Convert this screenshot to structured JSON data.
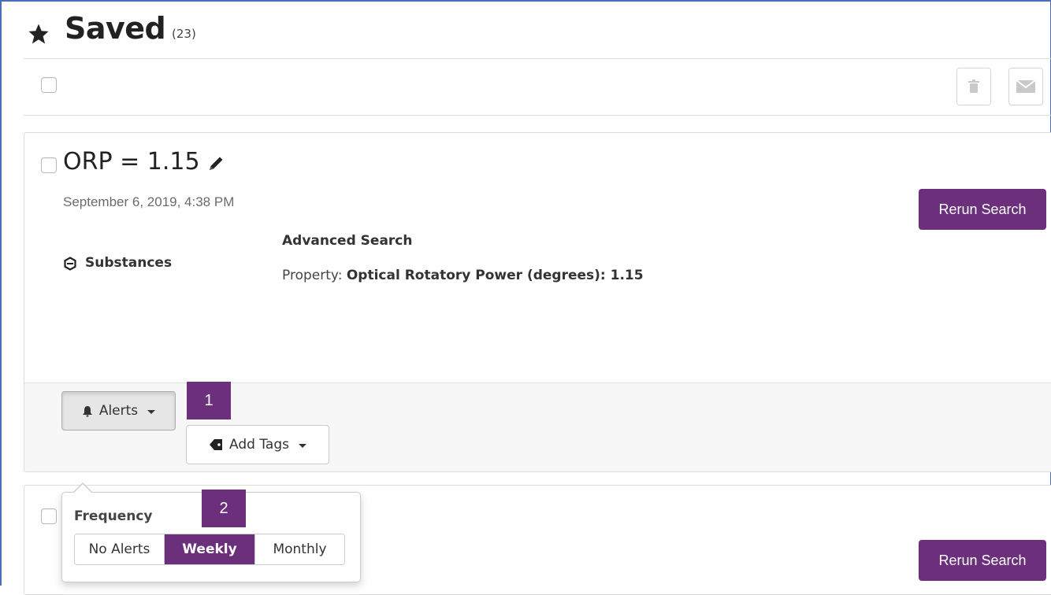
{
  "header": {
    "title": "Saved",
    "count": "(23)"
  },
  "toolbar": {
    "icons": [
      "trash-icon",
      "envelope-icon"
    ]
  },
  "searches": [
    {
      "title": "ORP = 1.15",
      "date": "September 6, 2019, 4:38 PM",
      "category": "Substances",
      "search_type": "Advanced Search",
      "property_label": "Property:",
      "property_value": "Optical Rotatory Power (degrees): 1.15",
      "rerun_label": "Rerun Search",
      "alerts_label": "Alerts",
      "tags_label": "Add Tags"
    },
    {
      "rerun_label": "Rerun Search"
    }
  ],
  "markers": [
    "1",
    "2"
  ],
  "alerts_popover": {
    "frequency_label": "Frequency",
    "options": [
      "No Alerts",
      "Weekly",
      "Monthly"
    ],
    "selected": "Weekly"
  },
  "colors": {
    "accent": "#6b2f7c",
    "frame": "#4a6fb5"
  }
}
